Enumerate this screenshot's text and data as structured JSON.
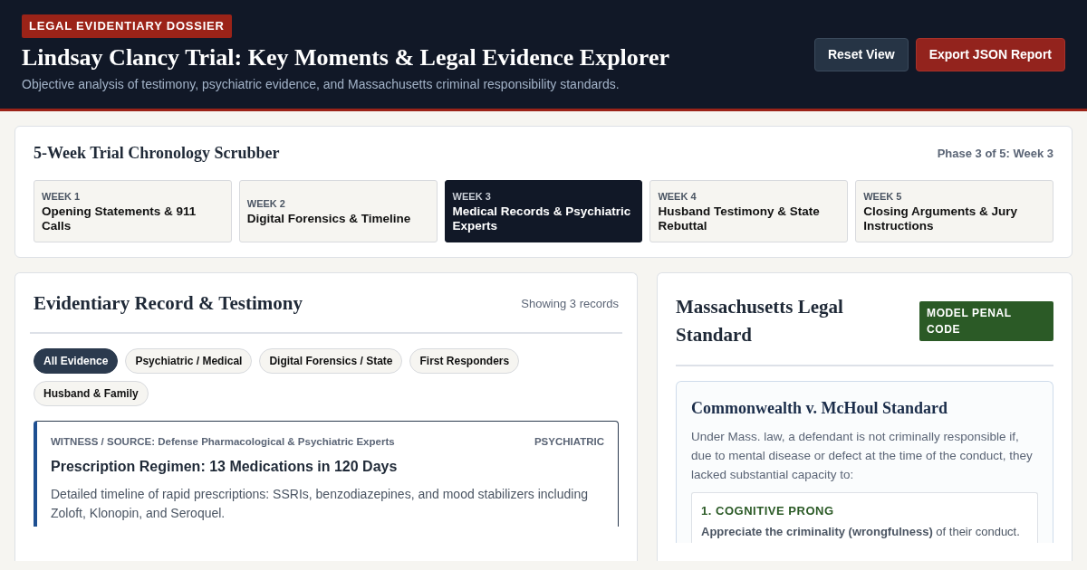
{
  "header": {
    "badge": "LEGAL EVIDENTIARY DOSSIER",
    "title": "Lindsay Clancy Trial: Key Moments & Legal Evidence Explorer",
    "subtitle": "Objective analysis of testimony, psychiatric evidence, and Massachusetts criminal responsibility standards.",
    "buttons": [
      {
        "label": "Reset View",
        "kind": "secondary"
      },
      {
        "label": "Export JSON Report",
        "kind": "primary"
      }
    ]
  },
  "scrubber": {
    "title": "5-Week Trial Chronology Scrubber",
    "phase": "Phase 3 of 5: Week 3",
    "weeks": [
      {
        "week": "WEEK 1",
        "label": "Opening Statements & 911 Calls",
        "selected": false
      },
      {
        "week": "WEEK 2",
        "label": "Digital Forensics & Timeline",
        "selected": false
      },
      {
        "week": "WEEK 3",
        "label": "Medical Records & Psychiatric Experts",
        "selected": true
      },
      {
        "week": "WEEK 4",
        "label": "Husband Testimony & State Rebuttal",
        "selected": false
      },
      {
        "week": "WEEK 5",
        "label": "Closing Arguments & Jury Instructions",
        "selected": false
      }
    ]
  },
  "evidence": {
    "title": "Evidentiary Record & Testimony",
    "count": "Showing 3 records",
    "filters": [
      {
        "label": "All Evidence",
        "selected": true
      },
      {
        "label": "Psychiatric / Medical",
        "selected": false
      },
      {
        "label": "Digital Forensics / State",
        "selected": false
      },
      {
        "label": "First Responders",
        "selected": false
      },
      {
        "label": "Husband & Family",
        "selected": false
      }
    ],
    "records": [
      {
        "source": "WITNESS / SOURCE: Defense Pharmacological & Psychiatric Experts",
        "category": "PSYCHIATRIC",
        "color": "#1d4f91",
        "title": "Prescription Regimen: 13 Medications in 120 Days",
        "description": "Detailed timeline of rapid prescriptions: SSRIs, benzodiazepines, and mood stabilizers including Zoloft, Klonopin, and Seroquel."
      }
    ]
  },
  "legal": {
    "title": "Massachusetts Legal Standard",
    "badge": "MODEL PENAL CODE",
    "standard": {
      "title": "Commonwealth v. McHoul Standard",
      "text": "Under Mass. law, a defendant is not criminally responsible if, due to mental disease or defect at the time of the conduct, they lacked substantial capacity to:",
      "prongs": [
        {
          "title": "1. COGNITIVE PRONG",
          "text": "**Appreciate the criminality (wrongfulness)** of their conduct."
        }
      ]
    }
  }
}
